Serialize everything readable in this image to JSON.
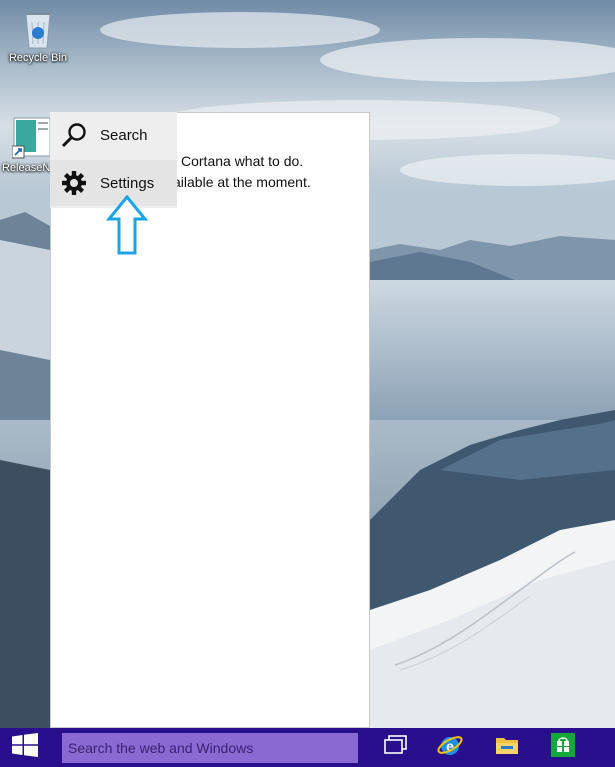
{
  "desktop": {
    "icons": [
      {
        "label": "Recycle Bin",
        "icon": "recycle-bin-icon"
      },
      {
        "label": "ReleaseN",
        "icon": "document-shortcut-icon"
      }
    ]
  },
  "start_panel": {
    "message_line1": "Cortana what to do.",
    "message_line2": "ailable at the moment."
  },
  "menu": {
    "items": [
      {
        "label": "Search",
        "icon": "search-icon"
      },
      {
        "label": "Settings",
        "icon": "gear-icon"
      }
    ]
  },
  "taskbar": {
    "search_placeholder": "Search the web and Windows",
    "buttons": [
      {
        "icon": "start-windows-icon"
      },
      {
        "icon": "task-view-icon"
      },
      {
        "icon": "internet-explorer-icon"
      },
      {
        "icon": "file-explorer-icon"
      },
      {
        "icon": "store-icon"
      }
    ]
  },
  "colors": {
    "taskbar": "#2a0f8c",
    "search_box": "#8a6ad2",
    "annotation_arrow": "#1aa3e6"
  }
}
